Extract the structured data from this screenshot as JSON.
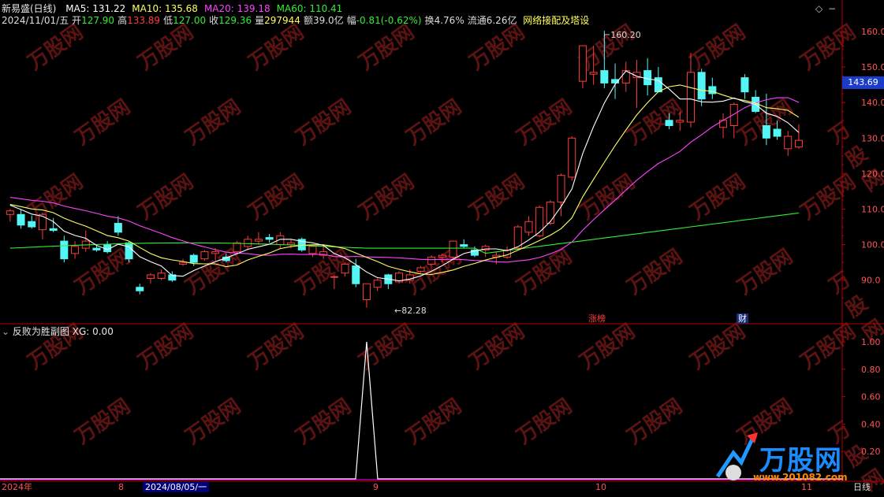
{
  "header": {
    "stock_name": "新易盛(日线)",
    "ma_labels": [
      {
        "text": "MA5: 131.22",
        "color": "#ffffff"
      },
      {
        "text": "MA10: 135.68",
        "color": "#ffff66"
      },
      {
        "text": "MA20: 139.18",
        "color": "#ff44ff"
      },
      {
        "text": "MA60: 110.41",
        "color": "#33ee33"
      }
    ],
    "date": "2024/11/01/五",
    "quotes": [
      {
        "label": "开",
        "value": "127.90",
        "color": "#33ee33"
      },
      {
        "label": "高",
        "value": "133.89",
        "color": "#ff3b3b"
      },
      {
        "label": "低",
        "value": "127.00",
        "color": "#33ee33"
      },
      {
        "label": "收",
        "value": "129.36",
        "color": "#33ee33"
      },
      {
        "label": "量",
        "value": "297944",
        "color": "#ffff55"
      },
      {
        "label": "额",
        "value": "39.0亿",
        "color": "#dddddd"
      },
      {
        "label": "幅",
        "value": "-0.81(-0.62%)",
        "color": "#33ee33"
      },
      {
        "label": "换",
        "value": "4.76%",
        "color": "#dddddd"
      },
      {
        "label": "流通",
        "value": "6.26亿",
        "color": "#dddddd"
      }
    ],
    "sector": "网络接配及塔设"
  },
  "main_chart": {
    "price_high_marker": "160.20",
    "price_low_marker": "82.28",
    "current_price_tag": "143.69",
    "event_labels": [
      "涨榜",
      "财"
    ]
  },
  "sub_panel": {
    "title": "反败为胜副图",
    "xg_label": "XG: 0.00"
  },
  "bottom_axis": {
    "labels": [
      "2024年",
      "8",
      "2024/08/05/一",
      "9",
      "10",
      "11"
    ],
    "period": "日线"
  },
  "watermark": {
    "brand": "万股网",
    "url": "www.201082.com"
  },
  "chart_data": [
    {
      "type": "candlestick",
      "ylim": [
        80,
        165
      ],
      "yticks": [
        90,
        100,
        110,
        120,
        130,
        140,
        150,
        160
      ],
      "ohlc": [
        [
          108.5,
          110.0,
          106.5,
          109.5
        ],
        [
          108.5,
          109.8,
          104.5,
          105.5
        ],
        [
          106.5,
          108.2,
          104.5,
          105.0
        ],
        [
          104.2,
          109.0,
          101.5,
          108.5
        ],
        [
          104.5,
          107.5,
          103.5,
          104.0
        ],
        [
          101.0,
          102.5,
          95.0,
          96.0
        ],
        [
          97.5,
          101.0,
          96.0,
          99.5
        ],
        [
          99.0,
          104.0,
          98.0,
          101.0
        ],
        [
          99.0,
          100.0,
          98.0,
          98.5
        ],
        [
          100.0,
          101.0,
          97.5,
          98.0
        ],
        [
          106.0,
          108.0,
          102.5,
          103.5
        ],
        [
          100.5,
          100.8,
          95.0,
          96.0
        ],
        [
          88.0,
          89.0,
          86.0,
          87.0
        ],
        [
          90.5,
          92.0,
          89.0,
          91.5
        ],
        [
          90.5,
          93.0,
          90.0,
          92.0
        ],
        [
          91.5,
          92.5,
          89.5,
          90.0
        ],
        [
          94.5,
          96.0,
          94.0,
          95.0
        ],
        [
          97.0,
          97.5,
          94.0,
          95.0
        ],
        [
          96.0,
          98.5,
          95.5,
          98.0
        ],
        [
          97.5,
          99.0,
          95.5,
          98.0
        ],
        [
          96.5,
          97.5,
          95.0,
          95.5
        ],
        [
          98.0,
          101.0,
          97.5,
          100.5
        ],
        [
          99.5,
          102.5,
          98.5,
          101.5
        ],
        [
          101.0,
          103.5,
          100.0,
          101.5
        ],
        [
          102.0,
          103.0,
          100.5,
          101.5
        ],
        [
          100.0,
          103.5,
          99.0,
          102.5
        ],
        [
          100.0,
          101.5,
          99.0,
          100.5
        ],
        [
          101.5,
          102.0,
          98.0,
          98.5
        ],
        [
          97.5,
          100.0,
          96.5,
          99.5
        ],
        [
          97.0,
          100.0,
          96.0,
          98.0
        ],
        [
          91.0,
          91.5,
          87.5,
          91.0
        ],
        [
          92.0,
          95.0,
          91.0,
          94.5
        ],
        [
          94.0,
          96.0,
          88.0,
          89.0
        ],
        [
          84.5,
          89.0,
          82.28,
          89.0
        ],
        [
          88.0,
          90.5,
          87.0,
          90.0
        ],
        [
          91.5,
          91.8,
          87.5,
          89.0
        ],
        [
          89.5,
          92.5,
          89.0,
          92.0
        ],
        [
          90.0,
          93.0,
          89.0,
          91.5
        ],
        [
          92.5,
          94.0,
          92.0,
          93.5
        ],
        [
          94.5,
          97.0,
          94.0,
          96.5
        ],
        [
          96.5,
          97.5,
          95.0,
          97.0
        ],
        [
          96.5,
          101.0,
          96.0,
          101.0
        ],
        [
          100.0,
          101.5,
          99.0,
          99.5
        ],
        [
          98.5,
          99.5,
          96.5,
          97.0
        ],
        [
          98.5,
          100.0,
          96.5,
          99.5
        ],
        [
          96.5,
          98.0,
          94.5,
          97.0
        ],
        [
          96.5,
          99.5,
          96.0,
          98.5
        ],
        [
          99.0,
          105.5,
          98.5,
          105.0
        ],
        [
          103.5,
          108.0,
          102.5,
          106.5
        ],
        [
          102.5,
          111.0,
          102.0,
          110.5
        ],
        [
          106.0,
          112.5,
          105.5,
          112.0
        ],
        [
          112.0,
          120.0,
          108.0,
          119.5
        ],
        [
          119.0,
          130.5,
          118.0,
          130.0
        ],
        [
          146.0,
          156.0,
          144.0,
          156.0
        ],
        [
          148.0,
          156.0,
          145.0,
          148.5
        ],
        [
          149.0,
          160.2,
          144.0,
          145.5
        ],
        [
          146.5,
          151.0,
          141.0,
          145.5
        ],
        [
          145.5,
          151.5,
          143.0,
          149.0
        ],
        [
          147.0,
          152.0,
          138.5,
          148.5
        ],
        [
          149.0,
          152.5,
          142.0,
          145.0
        ],
        [
          147.0,
          150.0,
          144.0,
          143.0
        ],
        [
          135.0,
          137.0,
          132.5,
          133.5
        ],
        [
          134.5,
          137.5,
          132.0,
          135.0
        ],
        [
          134.5,
          154.0,
          133.0,
          148.5
        ],
        [
          148.5,
          149.5,
          139.0,
          141.0
        ],
        [
          144.5,
          147.0,
          141.0,
          142.5
        ],
        [
          133.0,
          137.0,
          130.0,
          135.0
        ],
        [
          133.5,
          140.0,
          130.0,
          139.5
        ],
        [
          147.0,
          148.0,
          141.0,
          143.0
        ],
        [
          141.5,
          143.5,
          137.0,
          137.5
        ],
        [
          133.5,
          142.5,
          128.0,
          130.0
        ],
        [
          132.5,
          135.0,
          129.5,
          130.5
        ],
        [
          127.0,
          132.0,
          125.0,
          130.5
        ],
        [
          127.5,
          133.89,
          127.0,
          129.36
        ]
      ],
      "ma5_end": 131.22,
      "ma10_end": 135.68,
      "ma20_end": 139.18,
      "ma60_end": 110.41,
      "colors": {
        "up": "#ff3b3b",
        "down": "#54f5f5",
        "ma5": "#ffffff",
        "ma10": "#ffff66",
        "ma20": "#ff44ff",
        "ma60": "#33ee33"
      }
    },
    {
      "type": "line",
      "title": "反败为胜副图",
      "ylim": [
        0,
        1.1
      ],
      "yticks": [
        0.2,
        0.4,
        0.6,
        0.8,
        1.0
      ],
      "series": [
        {
          "name": "XG",
          "peak_index": 33,
          "peak_value": 1.0,
          "baseline": 0.0
        }
      ]
    }
  ]
}
